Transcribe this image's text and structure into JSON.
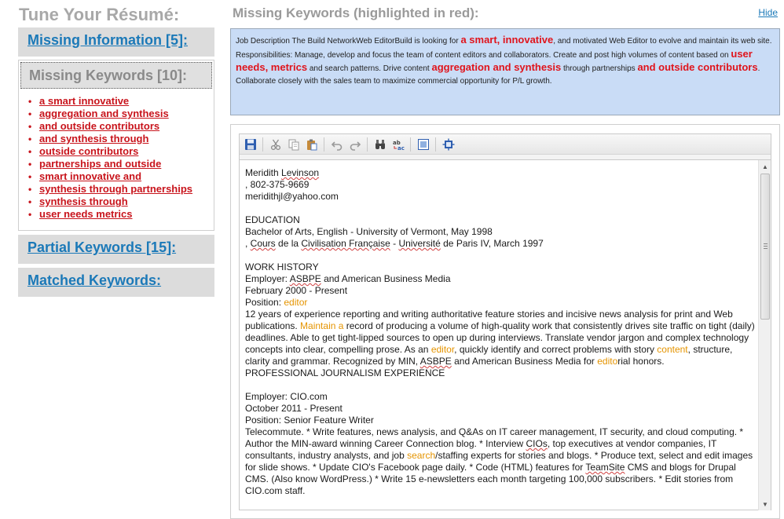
{
  "left": {
    "title": "Tune Your Résumé:",
    "missing_info_label": "Missing Information [5]:",
    "missing_keywords_label": "Missing Keywords [10]:",
    "missing_keywords": [
      "a smart innovative",
      "aggregation and synthesis",
      "and outside contributors",
      "and synthesis through",
      "outside contributors",
      "partnerships and outside",
      "smart innovative and",
      "synthesis through partnerships",
      "synthesis through",
      "user needs metrics"
    ],
    "partial_keywords_label": "Partial Keywords [15]:",
    "matched_keywords_label": "Matched Keywords:"
  },
  "right": {
    "title": "Missing Keywords (highlighted in red):",
    "hide_label": "Hide",
    "job_description": {
      "t1": "Job Description The Build NetworkWeb EditorBuild is looking for ",
      "k1": "a smart, innovative",
      "t2": ", and motivated Web Editor to evolve and maintain its web site. Responsibilities: Manage, develop and focus the team of content editors and collaborators.   Create and post high volumes of content based on ",
      "k2": "user needs, metrics",
      "t3": " and search patterns.   Drive content ",
      "k3": "aggregation and synthesis",
      "t4": " through partnerships ",
      "k4": "and outside contributors",
      "t5": ".   Collaborate closely with the sales team to maximize commercial opportunity for P/L growth."
    }
  },
  "editor": {
    "resume": {
      "name_first": "Meridith ",
      "name_last": "Levinson",
      "phone": ", 802-375-9669",
      "email": "meridithjl@yahoo.com",
      "edu_heading": "EDUCATION",
      "edu_1": "Bachelor of Arts, English - University of Vermont, May 1998",
      "edu_2a": ", ",
      "edu_2b": "Cours",
      "edu_2c": " de la ",
      "edu_2d": "Civilisation Française",
      "edu_2e": " - ",
      "edu_2f": "Université",
      "edu_2g": " de Paris IV, March 1997",
      "work_heading": "WORK HISTORY",
      "job1_employer_a": "Employer: ",
      "job1_employer_b": "ASBPE",
      "job1_employer_c": " and American Business Media",
      "job1_dates": "February 2000 - Present",
      "job1_position_a": "Position: ",
      "job1_position_b": "editor",
      "job1_d1": "12 years of experience reporting and writing authoritative feature stories and incisive news analysis for print and Web publications. ",
      "job1_d2": "Maintain a",
      "job1_d3": " record of producing a volume of high-quality work that consistently drives site traffic on tight (daily) deadlines. Able to get tight-lipped sources to open up during interviews. Translate vendor jargon and complex technology concepts into clear, compelling prose. As an ",
      "job1_d4": "editor",
      "job1_d5": ", quickly identify and correct problems with story ",
      "job1_d6": "content",
      "job1_d7": ", structure, clarity and grammar. Recognized by MIN, ",
      "job1_d8": "ASBPE",
      "job1_d9": " and American Business Media for ",
      "job1_d10": "edito",
      "job1_d11": "rial honors.",
      "job1_d12": "PROFESSIONAL JOURNALISM EXPERIENCE",
      "job2_employer": "Employer: CIO.com",
      "job2_dates": "October 2011 - Present",
      "job2_position": "Position: Senior Feature Writer",
      "job2_d1": "Telecommute. * Write features, news analysis, and Q&As on IT career management, IT security, and cloud computing. * Author the MIN-award winning Career Connection blog. * Interview ",
      "job2_d2": "CIOs",
      "job2_d3": ", top executives at vendor companies, IT consultants, industry analysts, and job ",
      "job2_d4": "search",
      "job2_d5": "/staffing experts for stories and blogs. * Produce text, select and edit images for slide shows. * Update CIO's Facebook page daily. * Code (HTML) features for ",
      "job2_d6": "TeamSite",
      "job2_d7": " CMS and blogs for Drupal CMS. (Also know WordPress.) * Write 15 e-newsletters each month targeting 100,000 subscribers. * Edit stories from CIO.com staff."
    }
  },
  "icons": [
    "save-icon",
    "cut-icon",
    "copy-icon",
    "paste-icon",
    "undo-icon",
    "redo-icon",
    "find-icon",
    "replace-icon",
    "select-all-icon",
    "spellcheck-icon"
  ],
  "colors": {
    "link_blue": "#1b79b8",
    "keyword_red": "#c8141c",
    "highlight_orange": "#e59400",
    "jd_background": "#c9dcf6",
    "panel_gray": "#dcdcdc"
  }
}
